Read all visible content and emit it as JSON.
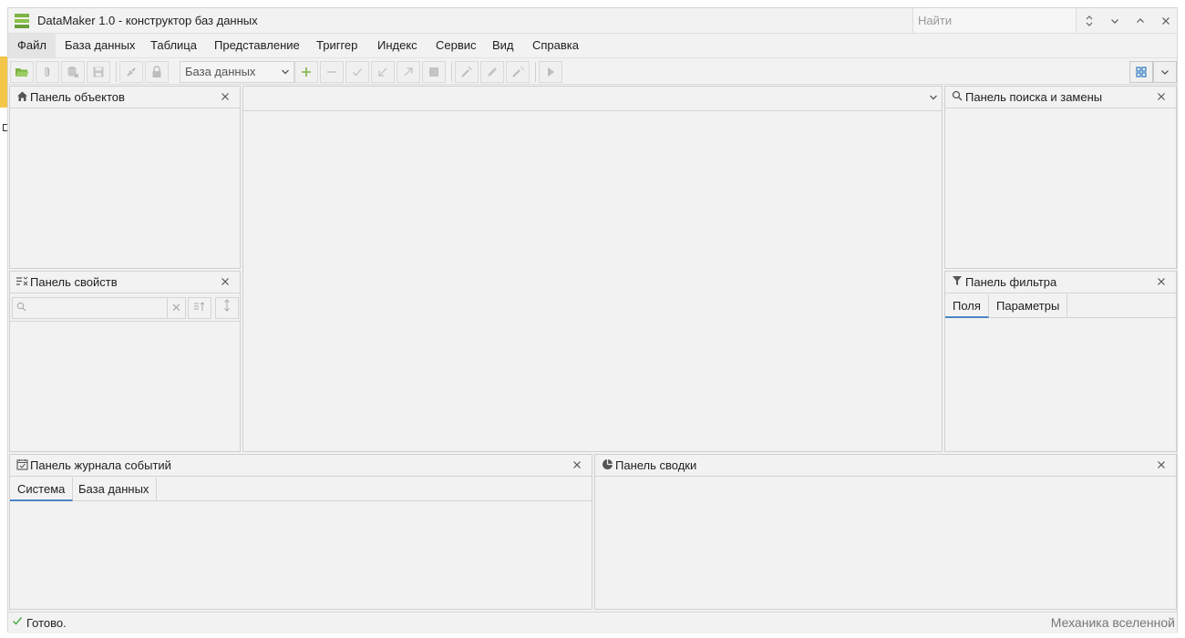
{
  "window": {
    "title": "DataMaker 1.0 - конструктор баз данных",
    "search_placeholder": "Найти",
    "controls": {
      "expand_icon": "⌃⌄",
      "minimize_icon": "⌄",
      "maximize_icon": "⌃",
      "close_icon": "✕"
    }
  },
  "menu": {
    "items": [
      {
        "label": "Файл",
        "active": true
      },
      {
        "label": "База данных"
      },
      {
        "label": "Таблица"
      },
      {
        "label": "Представление"
      },
      {
        "label": "Триггер"
      },
      {
        "label": "Индекс"
      },
      {
        "label": "Сервис"
      },
      {
        "label": "Вид"
      },
      {
        "label": "Справка"
      }
    ]
  },
  "toolbar": {
    "database_select_value": "База данных"
  },
  "panels": {
    "objects": {
      "title": "Панель объектов"
    },
    "properties": {
      "title": "Панель свойств"
    },
    "search_replace": {
      "title": "Панель поиска и замены"
    },
    "filter": {
      "title": "Панель фильтра",
      "tabs": [
        "Поля",
        "Параметры"
      ]
    },
    "event_log": {
      "title": "Панель журнала событий",
      "tabs": [
        "Система",
        "База данных"
      ]
    },
    "summary": {
      "title": "Панель сводки"
    }
  },
  "status": {
    "text": "Готово.",
    "right_text": "Механика вселенной"
  },
  "colors": {
    "accent": "#4a86c8",
    "brand_green": "#7cb342",
    "ok_green": "#4caf50"
  }
}
